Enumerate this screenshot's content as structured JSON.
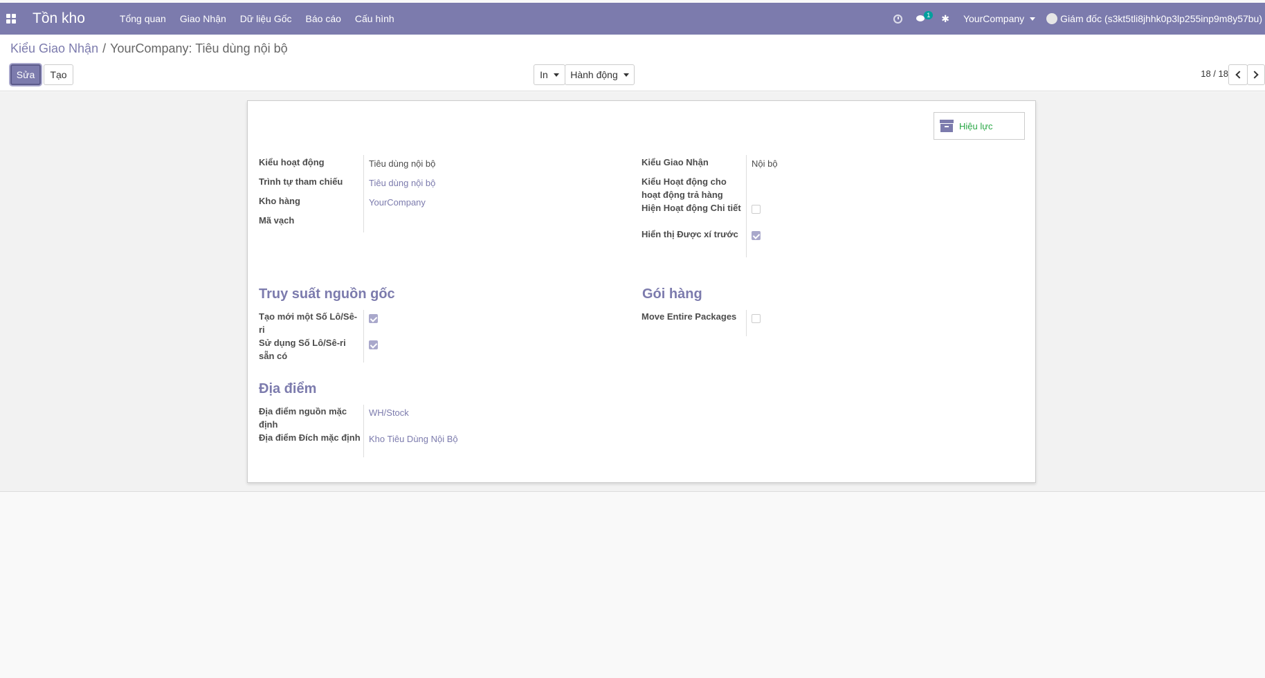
{
  "navbar": {
    "app_title": "Tồn kho",
    "menu": [
      "Tổng quan",
      "Giao Nhận",
      "Dữ liệu Gốc",
      "Báo cáo",
      "Cấu hình"
    ],
    "chat_badge": "1",
    "company": "YourCompany",
    "user": "Giám đốc (s3kt5tli8jhhk0p3lp255inp9m8y57bu)"
  },
  "breadcrumb": {
    "parent": "Kiểu Giao Nhận",
    "separator": "/",
    "current": "YourCompany: Tiêu dùng nội bộ"
  },
  "buttons": {
    "edit": "Sửa",
    "create": "Tạo",
    "print": "In",
    "action": "Hành động"
  },
  "pager": {
    "value": "18 / 18"
  },
  "record": {
    "active_button": "Hiệu lực",
    "left_fields": [
      {
        "label": "Kiểu hoạt động",
        "value": "Tiêu dùng nội bộ"
      },
      {
        "label": "Trình tự tham chiếu",
        "value": "Tiêu dùng nội bộ"
      },
      {
        "label": "Kho hàng",
        "value": "YourCompany"
      },
      {
        "label": "Mã vạch",
        "value": ""
      }
    ],
    "right_fields": [
      {
        "label": "Kiểu Giao Nhận",
        "value": "Nội bộ"
      },
      {
        "label": "Kiểu Hoạt động cho hoạt động trả hàng",
        "value": ""
      },
      {
        "label": "Hiện Hoạt động Chi tiết",
        "checked": false
      },
      {
        "label": "Hiển thị Được xí trước",
        "checked": true
      }
    ],
    "traceability": {
      "title": "Truy suất nguồn gốc",
      "fields": [
        {
          "label": "Tạo mới một Số Lô/Sê-ri",
          "checked": true
        },
        {
          "label": "Sử dụng Số Lô/Sê-ri sẵn có",
          "checked": true
        }
      ]
    },
    "packages": {
      "title": "Gói hàng",
      "fields": [
        {
          "label": "Move Entire Packages",
          "checked": false
        }
      ]
    },
    "locations": {
      "title": "Địa điểm",
      "fields": [
        {
          "label": "Địa điểm nguồn mặc định",
          "value": "WH/Stock"
        },
        {
          "label": "Địa điểm Đích mặc định",
          "value": "Kho Tiêu Dùng Nội Bộ"
        }
      ]
    }
  }
}
